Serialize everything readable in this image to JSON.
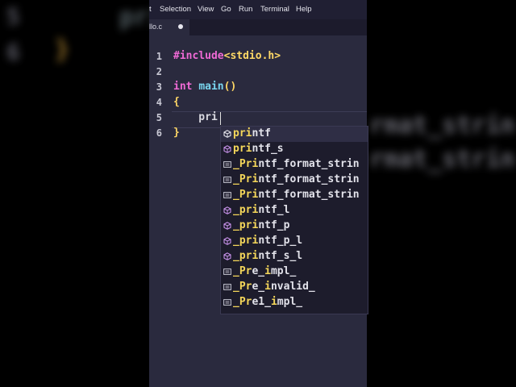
{
  "menu": {
    "items": [
      "t",
      "Selection",
      "View",
      "Go",
      "Run",
      "Terminal",
      "Help"
    ]
  },
  "tab": {
    "filename": "llo.c"
  },
  "background_echo": {
    "line_numbers": [
      "5",
      "6"
    ],
    "left_code": [
      "pri",
      "}"
    ],
    "right_suggestions": [
      "rmat_strin",
      "rmat_strin"
    ]
  },
  "editor": {
    "lines": [
      {
        "num": "1",
        "parts": [
          {
            "t": "#include",
            "c": "c-pre"
          },
          {
            "t": "<stdio.h>",
            "c": "c-hdr"
          }
        ]
      },
      {
        "num": "2",
        "parts": []
      },
      {
        "num": "3",
        "parts": [
          {
            "t": "int",
            "c": "c-kw"
          },
          {
            "t": " ",
            "c": ""
          },
          {
            "t": "main",
            "c": "c-fn"
          },
          {
            "t": "()",
            "c": "c-br"
          }
        ]
      },
      {
        "num": "4",
        "parts": [
          {
            "t": "{",
            "c": "c-br"
          }
        ]
      },
      {
        "num": "5",
        "parts": [
          {
            "t": "    pri",
            "c": ""
          }
        ]
      },
      {
        "num": "6",
        "parts": [
          {
            "t": "}",
            "c": "c-br"
          }
        ]
      }
    ]
  },
  "suggestions": [
    {
      "match": "pri",
      "rest": "ntf",
      "icon": "cube-icon",
      "selected": true
    },
    {
      "match": "pri",
      "rest": "ntf_s",
      "icon": "cube-icon"
    },
    {
      "match": "_Pri",
      "rest": "ntf_format_strin",
      "icon": "constant-icon"
    },
    {
      "match": "_Pri",
      "rest": "ntf_format_strin",
      "icon": "constant-icon"
    },
    {
      "match": "_Pri",
      "rest": "ntf_format_strin",
      "icon": "constant-icon"
    },
    {
      "match": "_pri",
      "rest": "ntf_l",
      "icon": "cube-icon"
    },
    {
      "match": "_pri",
      "rest": "ntf_p",
      "icon": "cube-icon"
    },
    {
      "match": "_pri",
      "rest": "ntf_p_l",
      "icon": "cube-icon"
    },
    {
      "match": "_pri",
      "rest": "ntf_s_l",
      "icon": "cube-icon"
    },
    {
      "segments": [
        {
          "t": "_Pr",
          "m": true
        },
        {
          "t": "e_",
          "m": false
        },
        {
          "t": "i",
          "m": true
        },
        {
          "t": "mpl_",
          "m": false
        }
      ],
      "icon": "constant-icon"
    },
    {
      "segments": [
        {
          "t": "_Pr",
          "m": true
        },
        {
          "t": "e_",
          "m": false
        },
        {
          "t": "i",
          "m": true
        },
        {
          "t": "nvalid_",
          "m": false
        }
      ],
      "icon": "constant-icon"
    },
    {
      "segments": [
        {
          "t": "_Pr",
          "m": true
        },
        {
          "t": "e1_",
          "m": false
        },
        {
          "t": "i",
          "m": true
        },
        {
          "t": "mpl_",
          "m": false
        }
      ],
      "icon": "constant-icon"
    }
  ],
  "colors": {
    "menubar": "#201f33",
    "editor_bg": "#2a2a3e",
    "keyword": "#f06ad6",
    "header": "#ffd866",
    "function": "#7ad7f0",
    "match": "#f5d75a",
    "method_icon": "#c792ea"
  }
}
